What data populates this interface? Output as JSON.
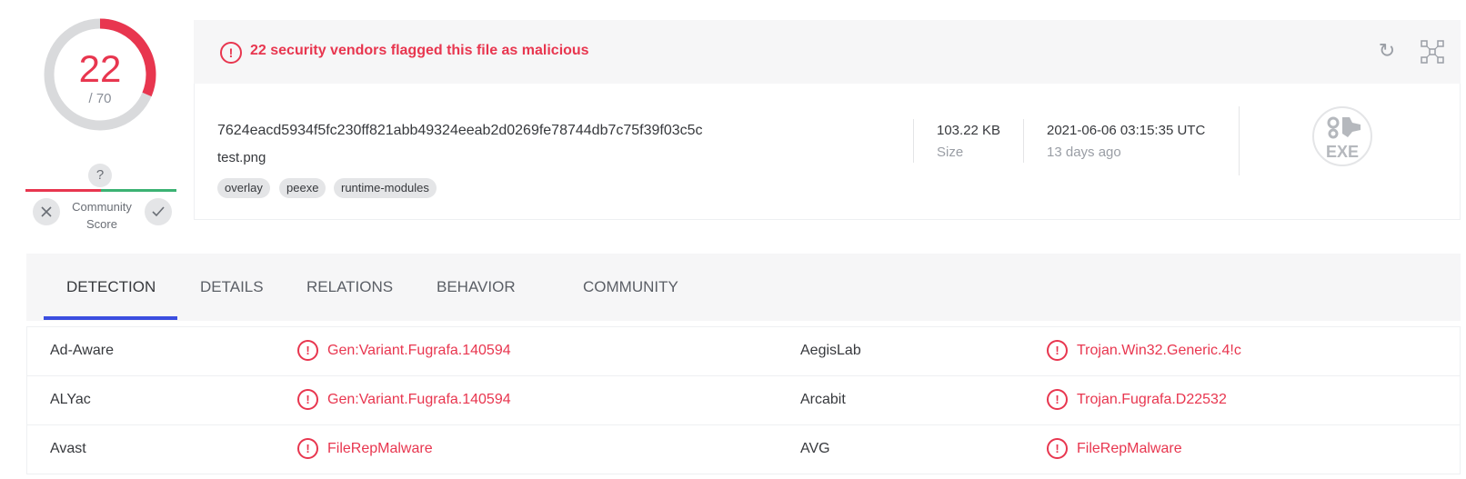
{
  "score": {
    "detected": "22",
    "total": "/ 70",
    "fraction": 0.314,
    "accent": "#e8364f"
  },
  "community": {
    "question_mark": "?",
    "label_line1": "Community",
    "label_line2": "Score",
    "vote_down_icon": "x-icon",
    "vote_up_icon": "check-icon"
  },
  "alert": {
    "text": "22 security vendors flagged this file as malicious",
    "icon": "!"
  },
  "file": {
    "hash": "7624eacd5934f5fc230ff821abb49324eeab2d0269fe78744db7c75f39f03c5c",
    "name": "test.png",
    "tags": [
      "overlay",
      "peexe",
      "runtime-modules"
    ],
    "size_value": "103.22 KB",
    "size_label": "Size",
    "date_value": "2021-06-06 03:15:35 UTC",
    "date_relative": "13 days ago",
    "type_badge": "EXE"
  },
  "tabs": [
    "DETECTION",
    "DETAILS",
    "RELATIONS",
    "BEHAVIOR",
    "COMMUNITY"
  ],
  "detections": [
    {
      "engine_left": "Ad-Aware",
      "result_left": "Gen:Variant.Fugrafa.140594",
      "engine_right": "AegisLab",
      "result_right": "Trojan.Win32.Generic.4!c"
    },
    {
      "engine_left": "ALYac",
      "result_left": "Gen:Variant.Fugrafa.140594",
      "engine_right": "Arcabit",
      "result_right": "Trojan.Fugrafa.D22532"
    },
    {
      "engine_left": "Avast",
      "result_left": "FileRepMalware",
      "engine_right": "AVG",
      "result_right": "FileRepMalware"
    }
  ]
}
